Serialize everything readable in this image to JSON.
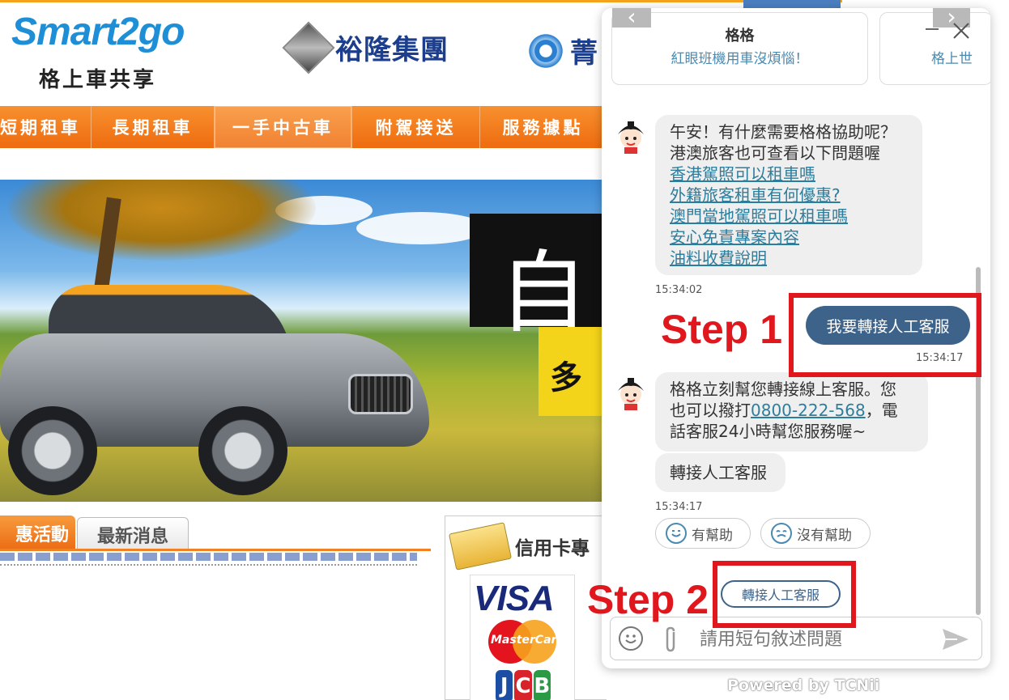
{
  "site": {
    "logo_text": "Smart2go",
    "logo_sub": "格上車共享",
    "partner_yulon": "裕隆集團",
    "partner_third": "菁",
    "nav": [
      {
        "label": "短期租車"
      },
      {
        "label": "長期租車"
      },
      {
        "label": "一手中古車"
      },
      {
        "label": "附駕接送"
      },
      {
        "label": "服務據點"
      }
    ],
    "hero_sign_glyph": "自",
    "hero_yellow_glyph": "多",
    "tabs": {
      "promo": "惠活動",
      "news": "最新消息"
    },
    "credit_title": "信用卡專",
    "card_visa": "VISA",
    "card_mastercard": "MasterCard",
    "card_jcb": [
      "J",
      "C",
      "B"
    ]
  },
  "chat": {
    "cards": [
      {
        "title": "格格",
        "subtitle": "紅眼班機用車沒煩惱！"
      },
      {
        "title": "",
        "subtitle": "格上世"
      }
    ],
    "messages": {
      "greeting_lines": [
        "午安！有什麼需要格格協助呢？",
        "港澳旅客也可查看以下問題喔"
      ],
      "links": [
        "香港駕照可以租車嗎",
        "外籍旅客租車有何優惠?",
        "澳門當地駕照可以租車嗎",
        "安心免責專案內容",
        "油料收費說明"
      ],
      "time_1": "15:34:02",
      "user_message": "我要轉接人工客服",
      "time_user": "15:34:17",
      "transfer_line1": "格格立刻幫您轉接線上客服。您",
      "transfer_line2_pre": "也可以撥打",
      "phone": "0800-222-568",
      "transfer_line2_post": "，電",
      "transfer_line3": "話客服24小時幫您服務喔~",
      "transfer_bubble": "轉接人工客服",
      "time_2": "15:34:17",
      "helpful": "有幫助",
      "not_helpful": "沒有幫助",
      "quick_reply": "轉接人工客服"
    },
    "input_placeholder": "請用短句敘述問題",
    "powered_by": "Powered by TCNii"
  },
  "annotations": {
    "step1": "Step 1",
    "step2": "Step 2",
    "highlight_color": "#e0171d"
  },
  "icons": [
    "close-icon",
    "minimize-icon",
    "emoji-icon",
    "paperclip-icon",
    "send-icon",
    "smile-face-icon",
    "neutral-face-icon",
    "bot-avatar-icon"
  ]
}
